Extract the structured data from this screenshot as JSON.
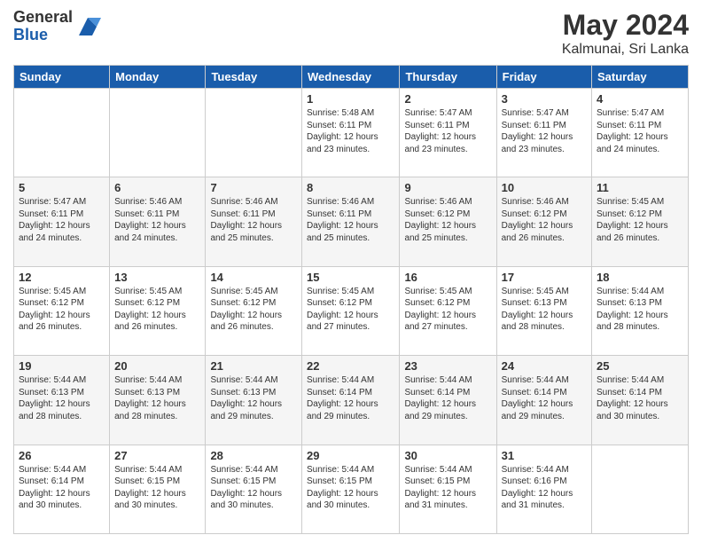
{
  "header": {
    "logo_general": "General",
    "logo_blue": "Blue",
    "month_title": "May 2024",
    "location": "Kalmunai, Sri Lanka"
  },
  "days_of_week": [
    "Sunday",
    "Monday",
    "Tuesday",
    "Wednesday",
    "Thursday",
    "Friday",
    "Saturday"
  ],
  "weeks": [
    [
      {
        "day": "",
        "info": ""
      },
      {
        "day": "",
        "info": ""
      },
      {
        "day": "",
        "info": ""
      },
      {
        "day": "1",
        "info": "Sunrise: 5:48 AM\nSunset: 6:11 PM\nDaylight: 12 hours\nand 23 minutes."
      },
      {
        "day": "2",
        "info": "Sunrise: 5:47 AM\nSunset: 6:11 PM\nDaylight: 12 hours\nand 23 minutes."
      },
      {
        "day": "3",
        "info": "Sunrise: 5:47 AM\nSunset: 6:11 PM\nDaylight: 12 hours\nand 23 minutes."
      },
      {
        "day": "4",
        "info": "Sunrise: 5:47 AM\nSunset: 6:11 PM\nDaylight: 12 hours\nand 24 minutes."
      }
    ],
    [
      {
        "day": "5",
        "info": "Sunrise: 5:47 AM\nSunset: 6:11 PM\nDaylight: 12 hours\nand 24 minutes."
      },
      {
        "day": "6",
        "info": "Sunrise: 5:46 AM\nSunset: 6:11 PM\nDaylight: 12 hours\nand 24 minutes."
      },
      {
        "day": "7",
        "info": "Sunrise: 5:46 AM\nSunset: 6:11 PM\nDaylight: 12 hours\nand 25 minutes."
      },
      {
        "day": "8",
        "info": "Sunrise: 5:46 AM\nSunset: 6:11 PM\nDaylight: 12 hours\nand 25 minutes."
      },
      {
        "day": "9",
        "info": "Sunrise: 5:46 AM\nSunset: 6:12 PM\nDaylight: 12 hours\nand 25 minutes."
      },
      {
        "day": "10",
        "info": "Sunrise: 5:46 AM\nSunset: 6:12 PM\nDaylight: 12 hours\nand 26 minutes."
      },
      {
        "day": "11",
        "info": "Sunrise: 5:45 AM\nSunset: 6:12 PM\nDaylight: 12 hours\nand 26 minutes."
      }
    ],
    [
      {
        "day": "12",
        "info": "Sunrise: 5:45 AM\nSunset: 6:12 PM\nDaylight: 12 hours\nand 26 minutes."
      },
      {
        "day": "13",
        "info": "Sunrise: 5:45 AM\nSunset: 6:12 PM\nDaylight: 12 hours\nand 26 minutes."
      },
      {
        "day": "14",
        "info": "Sunrise: 5:45 AM\nSunset: 6:12 PM\nDaylight: 12 hours\nand 26 minutes."
      },
      {
        "day": "15",
        "info": "Sunrise: 5:45 AM\nSunset: 6:12 PM\nDaylight: 12 hours\nand 27 minutes."
      },
      {
        "day": "16",
        "info": "Sunrise: 5:45 AM\nSunset: 6:12 PM\nDaylight: 12 hours\nand 27 minutes."
      },
      {
        "day": "17",
        "info": "Sunrise: 5:45 AM\nSunset: 6:13 PM\nDaylight: 12 hours\nand 28 minutes."
      },
      {
        "day": "18",
        "info": "Sunrise: 5:44 AM\nSunset: 6:13 PM\nDaylight: 12 hours\nand 28 minutes."
      }
    ],
    [
      {
        "day": "19",
        "info": "Sunrise: 5:44 AM\nSunset: 6:13 PM\nDaylight: 12 hours\nand 28 minutes."
      },
      {
        "day": "20",
        "info": "Sunrise: 5:44 AM\nSunset: 6:13 PM\nDaylight: 12 hours\nand 28 minutes."
      },
      {
        "day": "21",
        "info": "Sunrise: 5:44 AM\nSunset: 6:13 PM\nDaylight: 12 hours\nand 29 minutes."
      },
      {
        "day": "22",
        "info": "Sunrise: 5:44 AM\nSunset: 6:14 PM\nDaylight: 12 hours\nand 29 minutes."
      },
      {
        "day": "23",
        "info": "Sunrise: 5:44 AM\nSunset: 6:14 PM\nDaylight: 12 hours\nand 29 minutes."
      },
      {
        "day": "24",
        "info": "Sunrise: 5:44 AM\nSunset: 6:14 PM\nDaylight: 12 hours\nand 29 minutes."
      },
      {
        "day": "25",
        "info": "Sunrise: 5:44 AM\nSunset: 6:14 PM\nDaylight: 12 hours\nand 30 minutes."
      }
    ],
    [
      {
        "day": "26",
        "info": "Sunrise: 5:44 AM\nSunset: 6:14 PM\nDaylight: 12 hours\nand 30 minutes."
      },
      {
        "day": "27",
        "info": "Sunrise: 5:44 AM\nSunset: 6:15 PM\nDaylight: 12 hours\nand 30 minutes."
      },
      {
        "day": "28",
        "info": "Sunrise: 5:44 AM\nSunset: 6:15 PM\nDaylight: 12 hours\nand 30 minutes."
      },
      {
        "day": "29",
        "info": "Sunrise: 5:44 AM\nSunset: 6:15 PM\nDaylight: 12 hours\nand 30 minutes."
      },
      {
        "day": "30",
        "info": "Sunrise: 5:44 AM\nSunset: 6:15 PM\nDaylight: 12 hours\nand 31 minutes."
      },
      {
        "day": "31",
        "info": "Sunrise: 5:44 AM\nSunset: 6:16 PM\nDaylight: 12 hours\nand 31 minutes."
      },
      {
        "day": "",
        "info": ""
      }
    ]
  ]
}
